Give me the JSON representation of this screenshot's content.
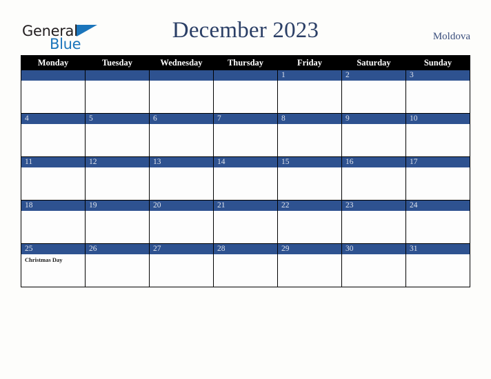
{
  "brand": {
    "word1": "General",
    "word2": "Blue",
    "triangle_color": "#1b75bb"
  },
  "header": {
    "title": "December 2023",
    "country": "Moldova"
  },
  "theme": {
    "accent_blue": "#2e5290",
    "header_black": "#000000",
    "title_navy": "#2b3f66",
    "page_background": "#fdfdfb"
  },
  "calendar": {
    "weekday_headers": [
      "Monday",
      "Tuesday",
      "Wednesday",
      "Thursday",
      "Friday",
      "Saturday",
      "Sunday"
    ],
    "weeks": [
      [
        {
          "date": "",
          "event": ""
        },
        {
          "date": "",
          "event": ""
        },
        {
          "date": "",
          "event": ""
        },
        {
          "date": "",
          "event": ""
        },
        {
          "date": "1",
          "event": ""
        },
        {
          "date": "2",
          "event": ""
        },
        {
          "date": "3",
          "event": ""
        }
      ],
      [
        {
          "date": "4",
          "event": ""
        },
        {
          "date": "5",
          "event": ""
        },
        {
          "date": "6",
          "event": ""
        },
        {
          "date": "7",
          "event": ""
        },
        {
          "date": "8",
          "event": ""
        },
        {
          "date": "9",
          "event": ""
        },
        {
          "date": "10",
          "event": ""
        }
      ],
      [
        {
          "date": "11",
          "event": ""
        },
        {
          "date": "12",
          "event": ""
        },
        {
          "date": "13",
          "event": ""
        },
        {
          "date": "14",
          "event": ""
        },
        {
          "date": "15",
          "event": ""
        },
        {
          "date": "16",
          "event": ""
        },
        {
          "date": "17",
          "event": ""
        }
      ],
      [
        {
          "date": "18",
          "event": ""
        },
        {
          "date": "19",
          "event": ""
        },
        {
          "date": "20",
          "event": ""
        },
        {
          "date": "21",
          "event": ""
        },
        {
          "date": "22",
          "event": ""
        },
        {
          "date": "23",
          "event": ""
        },
        {
          "date": "24",
          "event": ""
        }
      ],
      [
        {
          "date": "25",
          "event": "Christmas Day"
        },
        {
          "date": "26",
          "event": ""
        },
        {
          "date": "27",
          "event": ""
        },
        {
          "date": "28",
          "event": ""
        },
        {
          "date": "29",
          "event": ""
        },
        {
          "date": "30",
          "event": ""
        },
        {
          "date": "31",
          "event": ""
        }
      ]
    ]
  }
}
